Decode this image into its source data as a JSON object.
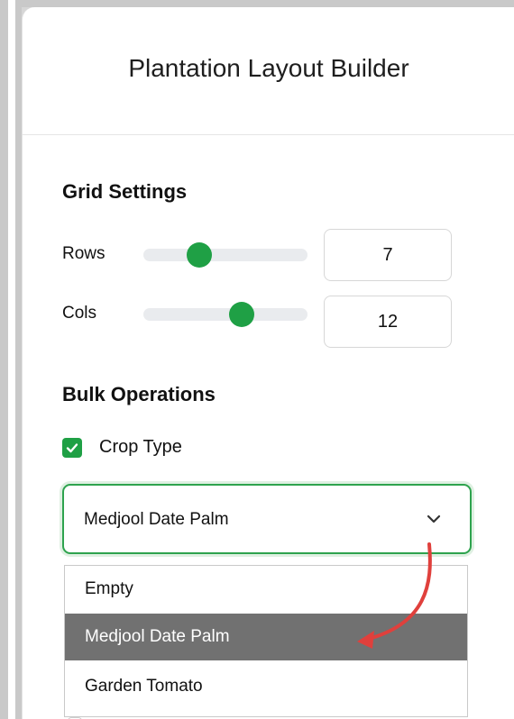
{
  "panel": {
    "title": "Plantation Layout Builder"
  },
  "grid_settings": {
    "title": "Grid Settings",
    "rows": {
      "label": "Rows",
      "value": "7",
      "slider_fraction": 0.34
    },
    "cols": {
      "label": "Cols",
      "value": "12",
      "slider_fraction": 0.6
    }
  },
  "bulk_operations": {
    "title": "Bulk Operations",
    "crop_type": {
      "label": "Crop Type",
      "checked": true
    },
    "select": {
      "value": "Medjool Date Palm",
      "options": [
        "Empty",
        "Medjool Date Palm",
        "Garden Tomato"
      ],
      "highlighted_index": 1
    }
  },
  "colors": {
    "accent": "#1fa045",
    "highlight": "#717171",
    "arrow": "#e0403c"
  }
}
